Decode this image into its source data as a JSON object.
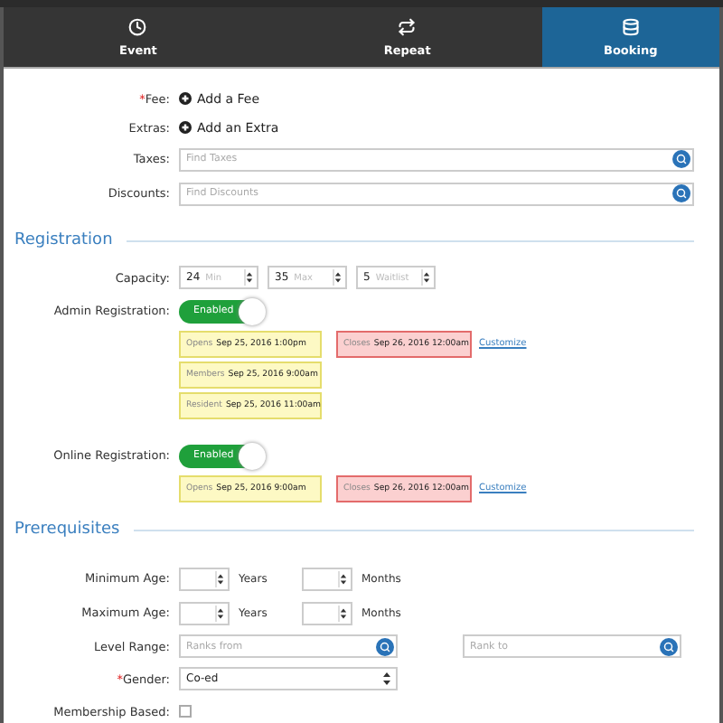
{
  "tabs": [
    {
      "label": "Event",
      "kind": "clock",
      "selected": false
    },
    {
      "label": "Repeat",
      "kind": "repeat",
      "selected": false
    },
    {
      "label": "Booking",
      "kind": "database",
      "selected": true
    }
  ],
  "general": [
    {
      "kind": "action",
      "mark": "*",
      "label": "Fee:",
      "text": "Add a Fee"
    },
    {
      "kind": "action",
      "label": "Extras:",
      "text": "Add an Extra"
    },
    {
      "kind": "search",
      "label": "Taxes:",
      "placeholder": "Find Taxes"
    },
    {
      "kind": "search",
      "label": "Discounts:",
      "placeholder": "Find Discounts"
    }
  ],
  "registration": {
    "title": "Registration",
    "capacity": {
      "label": "Capacity:",
      "inputs": [
        {
          "value": "24",
          "suffix": "Min"
        },
        {
          "value": "35",
          "suffix": "Max"
        },
        {
          "value": "5",
          "suffix": "Waitlist"
        }
      ]
    },
    "registrations": [
      {
        "label": "Admin Registration:",
        "toggle": {
          "on": true,
          "text": "Enabled"
        },
        "opens": [
          {
            "caption": "Opens",
            "value": "Sep 25, 2016 1:00pm"
          },
          {
            "caption": "Members",
            "value": "Sep 25, 2016 9:00am"
          },
          {
            "caption": "Resident",
            "value": "Sep 25, 2016 11:00am"
          }
        ],
        "closes": {
          "caption": "Closes",
          "value": "Sep 26, 2016 12:00am"
        },
        "link": "Customize"
      },
      {
        "label": "Online Registration:",
        "toggle": {
          "on": true,
          "text": "Enabled"
        },
        "opens": [
          {
            "caption": "Opens",
            "value": "Sep 25, 2016 9:00am"
          }
        ],
        "closes": {
          "caption": "Closes",
          "value": "Sep 26, 2016 12:00am"
        },
        "link": "Customize"
      }
    ]
  },
  "prerequisites": {
    "title": "Prerequisites",
    "rows": [
      {
        "kind": "age",
        "label": "Minimum Age:",
        "units": [
          "Years",
          "Months"
        ]
      },
      {
        "kind": "age",
        "label": "Maximum Age:",
        "units": [
          "Years",
          "Months"
        ]
      },
      {
        "kind": "range",
        "label": "Level Range:",
        "placeholders": [
          "Ranks from",
          "Rank to"
        ]
      },
      {
        "kind": "select",
        "mark": "*",
        "label": "Gender:",
        "value": "Co-ed"
      },
      {
        "kind": "checkbox",
        "label": "Membership Based:",
        "checked": false
      }
    ]
  }
}
